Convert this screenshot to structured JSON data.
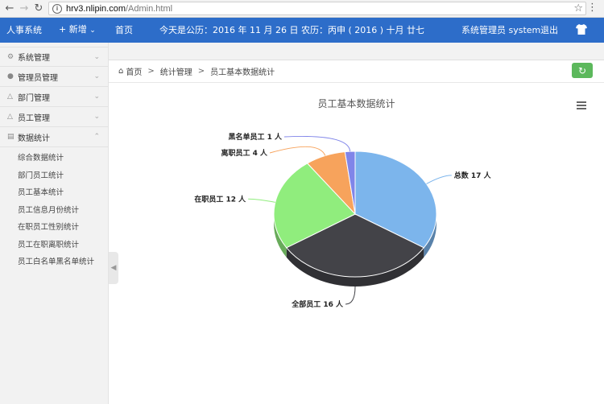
{
  "browser": {
    "url_host": "hrv3.nlipin.com",
    "url_path": "/Admin.html"
  },
  "header": {
    "brand": "人事系统",
    "new_label": "+ 新增",
    "home_label": "首页",
    "date_text": "今天是公历：2016 年 11 月 26 日   农历：丙申 ( 2016 )  十月 廿七",
    "user_text": "系统管理员  system",
    "logout_label": "退出"
  },
  "sidebar": {
    "items": [
      {
        "label": "系统管理",
        "icon": "gear-icon"
      },
      {
        "label": "管理员管理",
        "icon": "user-icon"
      },
      {
        "label": "部门管理",
        "icon": "org-icon"
      },
      {
        "label": "员工管理",
        "icon": "employee-icon"
      },
      {
        "label": "数据统计",
        "icon": "chart-icon"
      }
    ],
    "subitems": [
      "综合数据统计",
      "部门员工统计",
      "员工基本统计",
      "员工信息月份统计",
      "在职员工性别统计",
      "员工在职离职统计",
      "员工白名单黑名单统计"
    ]
  },
  "breadcrumb": {
    "home": "首页",
    "level1": "统计管理",
    "level2": "员工基本数据统计"
  },
  "chart_data": {
    "type": "pie",
    "title": "员工基本数据统计",
    "slices": [
      {
        "name": "总数",
        "value": 17,
        "label": "总数 17 人",
        "color": "#7cb5ec"
      },
      {
        "name": "全部员工",
        "value": 16,
        "label": "全部员工 16 人",
        "color": "#434348"
      },
      {
        "name": "在职员工",
        "value": 12,
        "label": "在职员工 12 人",
        "color": "#90ed7d"
      },
      {
        "name": "离职员工",
        "value": 4,
        "label": "离职员工 4 人",
        "color": "#f7a35c"
      },
      {
        "name": "黑名单员工",
        "value": 1,
        "label": "黑名单员工 1 人",
        "color": "#8085e9"
      }
    ]
  }
}
